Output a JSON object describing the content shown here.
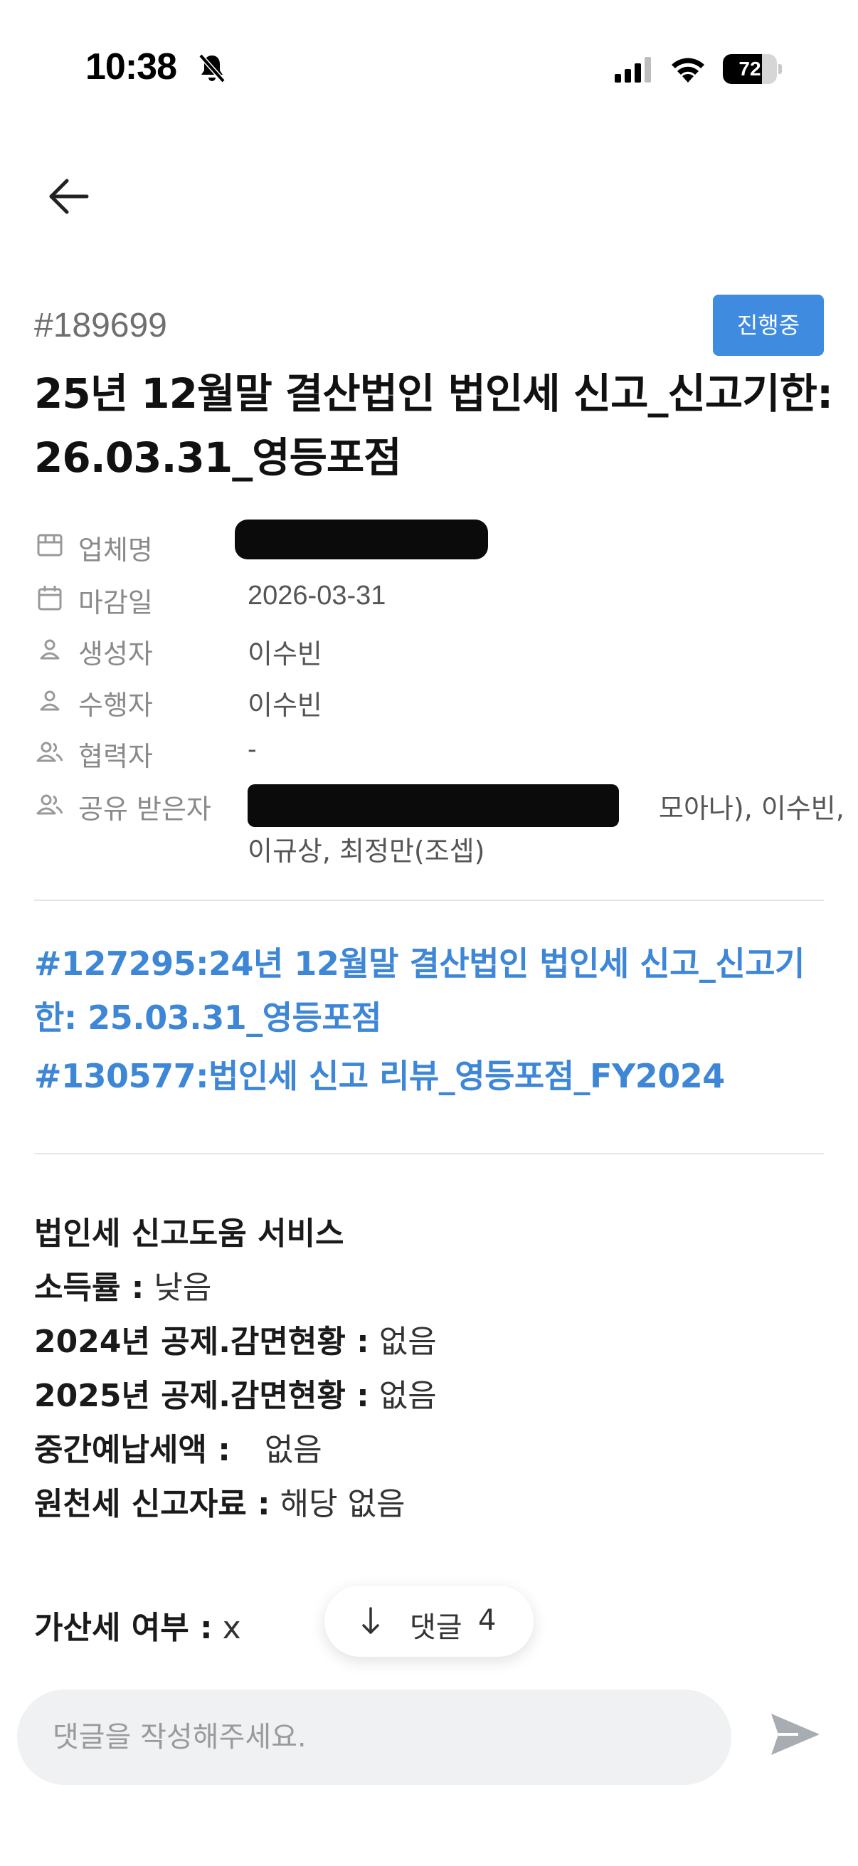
{
  "status_bar": {
    "time": "10:38",
    "battery": "72",
    "battery_fraction": 0.72
  },
  "ticket": {
    "id": "#189699",
    "status": "진행중",
    "title": "25년 12월말 결산법인 법인세 신고_신고기한: 26.03.31_영등포점"
  },
  "info": {
    "company_label": "업체명",
    "due_label": "마감일",
    "due_value": "2026-03-31",
    "creator_label": "생성자",
    "creator_value": "이수빈",
    "assignee_label": "수행자",
    "assignee_value": "이수빈",
    "collaborator_label": "협력자",
    "collaborator_value": "-",
    "shared_label": "공유 받은자",
    "shared_value_line1": "모아나), 이수빈,",
    "shared_value_line2": "이규상, 최정만(조셉)"
  },
  "linked": [
    {
      "text": "#127295:24년 12월말 결산법인 법인세 신고_신고기한: 25.03.31_영등포점"
    },
    {
      "text": "#130577:법인세 신고 리뷰_영등포점_FY2024"
    }
  ],
  "body": {
    "heading": "법인세 신고도움 서비스",
    "rows": [
      {
        "label": "소득률 :",
        "value": "낮음"
      },
      {
        "label": "2024년 공제.감면현황 :",
        "value": "없음"
      },
      {
        "label": "2025년 공제.감면현황 :",
        "value": "없음"
      },
      {
        "label": "중간예납세액 :",
        "value": "없음"
      },
      {
        "label": "원천세 신고자료 :",
        "value": "해당 없음"
      }
    ],
    "penalty_label": "가산세 여부 :",
    "penalty_value": "x"
  },
  "comments": {
    "label": "댓글",
    "count": "4"
  },
  "comment_input": {
    "placeholder": "댓글을 작성해주세요."
  },
  "colors": {
    "accent": "#3e8bdf",
    "link": "#3e86d6",
    "muted": "#8a8a8a"
  }
}
